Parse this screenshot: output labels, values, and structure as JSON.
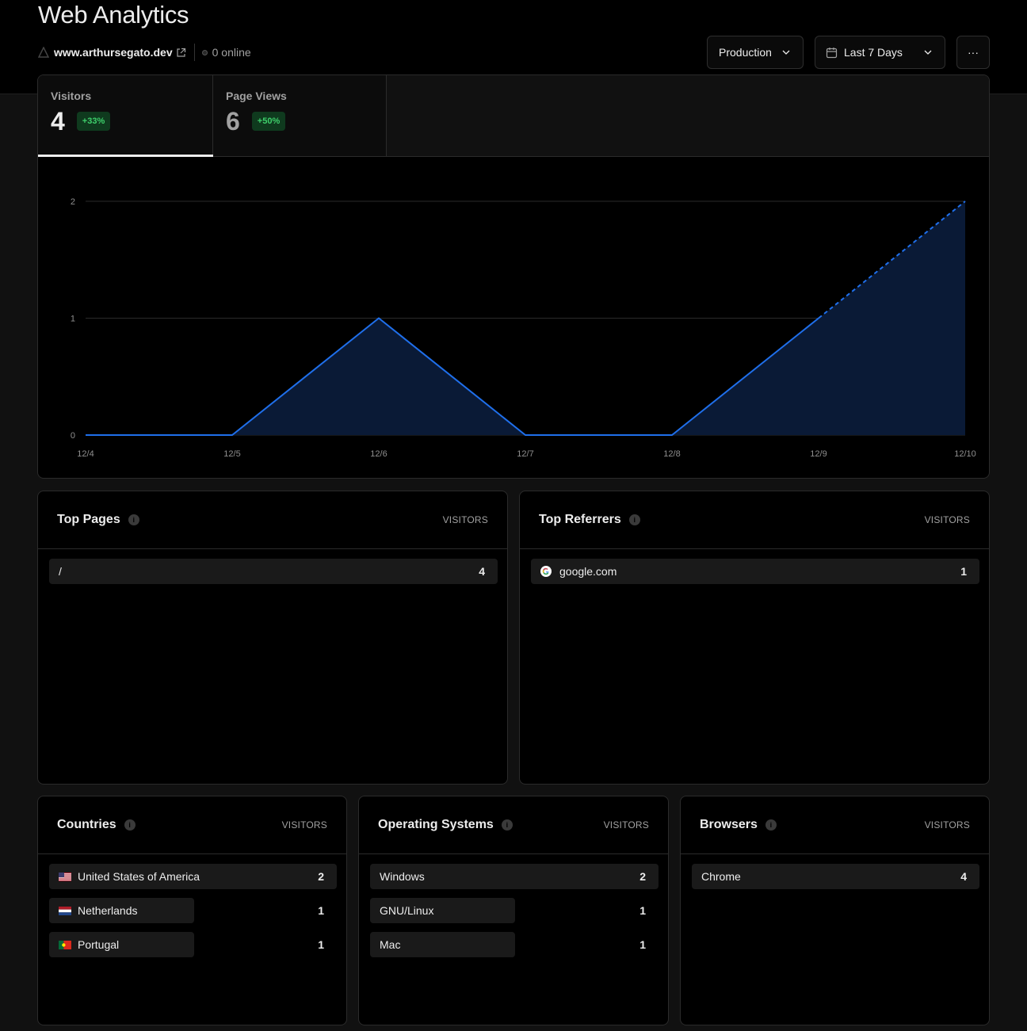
{
  "page": {
    "title": "Web Analytics"
  },
  "site": {
    "domain": "www.arthursegato.dev",
    "online": "0 online"
  },
  "controls": {
    "environment": "Production",
    "range": "Last 7 Days",
    "more": "···"
  },
  "stats": {
    "visitors": {
      "label": "Visitors",
      "value": "4",
      "change": "+33%"
    },
    "page_views": {
      "label": "Page Views",
      "value": "6",
      "change": "+50%"
    }
  },
  "chart_data": {
    "type": "area",
    "x": [
      "12/4",
      "12/5",
      "12/6",
      "12/7",
      "12/8",
      "12/9",
      "12/10"
    ],
    "series": [
      {
        "values": [
          0,
          0,
          1,
          0,
          0,
          1,
          2
        ]
      }
    ],
    "ylim": [
      0,
      2
    ],
    "yticks": [
      "0",
      "1",
      "2"
    ],
    "grid": true,
    "dashed_from_index": 5,
    "colors": {
      "line": "#1f6feb",
      "fill": "#0a1a36"
    }
  },
  "panels": {
    "top_pages": {
      "title": "Top Pages",
      "column": "VISITORS",
      "rows": [
        {
          "label": "/",
          "count": "4"
        }
      ]
    },
    "top_referrers": {
      "title": "Top Referrers",
      "column": "VISITORS",
      "rows": [
        {
          "label": "google.com",
          "count": "1",
          "icon": "google-icon"
        }
      ]
    },
    "countries": {
      "title": "Countries",
      "column": "VISITORS",
      "rows": [
        {
          "label": "United States of America",
          "count": "2",
          "icon": "us-flag-icon"
        },
        {
          "label": "Netherlands",
          "count": "1",
          "icon": "nl-flag-icon"
        },
        {
          "label": "Portugal",
          "count": "1",
          "icon": "pt-flag-icon"
        }
      ]
    },
    "operating_systems": {
      "title": "Operating Systems",
      "column": "VISITORS",
      "rows": [
        {
          "label": "Windows",
          "count": "2"
        },
        {
          "label": "GNU/Linux",
          "count": "1"
        },
        {
          "label": "Mac",
          "count": "1"
        }
      ]
    },
    "browsers": {
      "title": "Browsers",
      "column": "VISITORS",
      "rows": [
        {
          "label": "Chrome",
          "count": "4"
        }
      ]
    }
  }
}
